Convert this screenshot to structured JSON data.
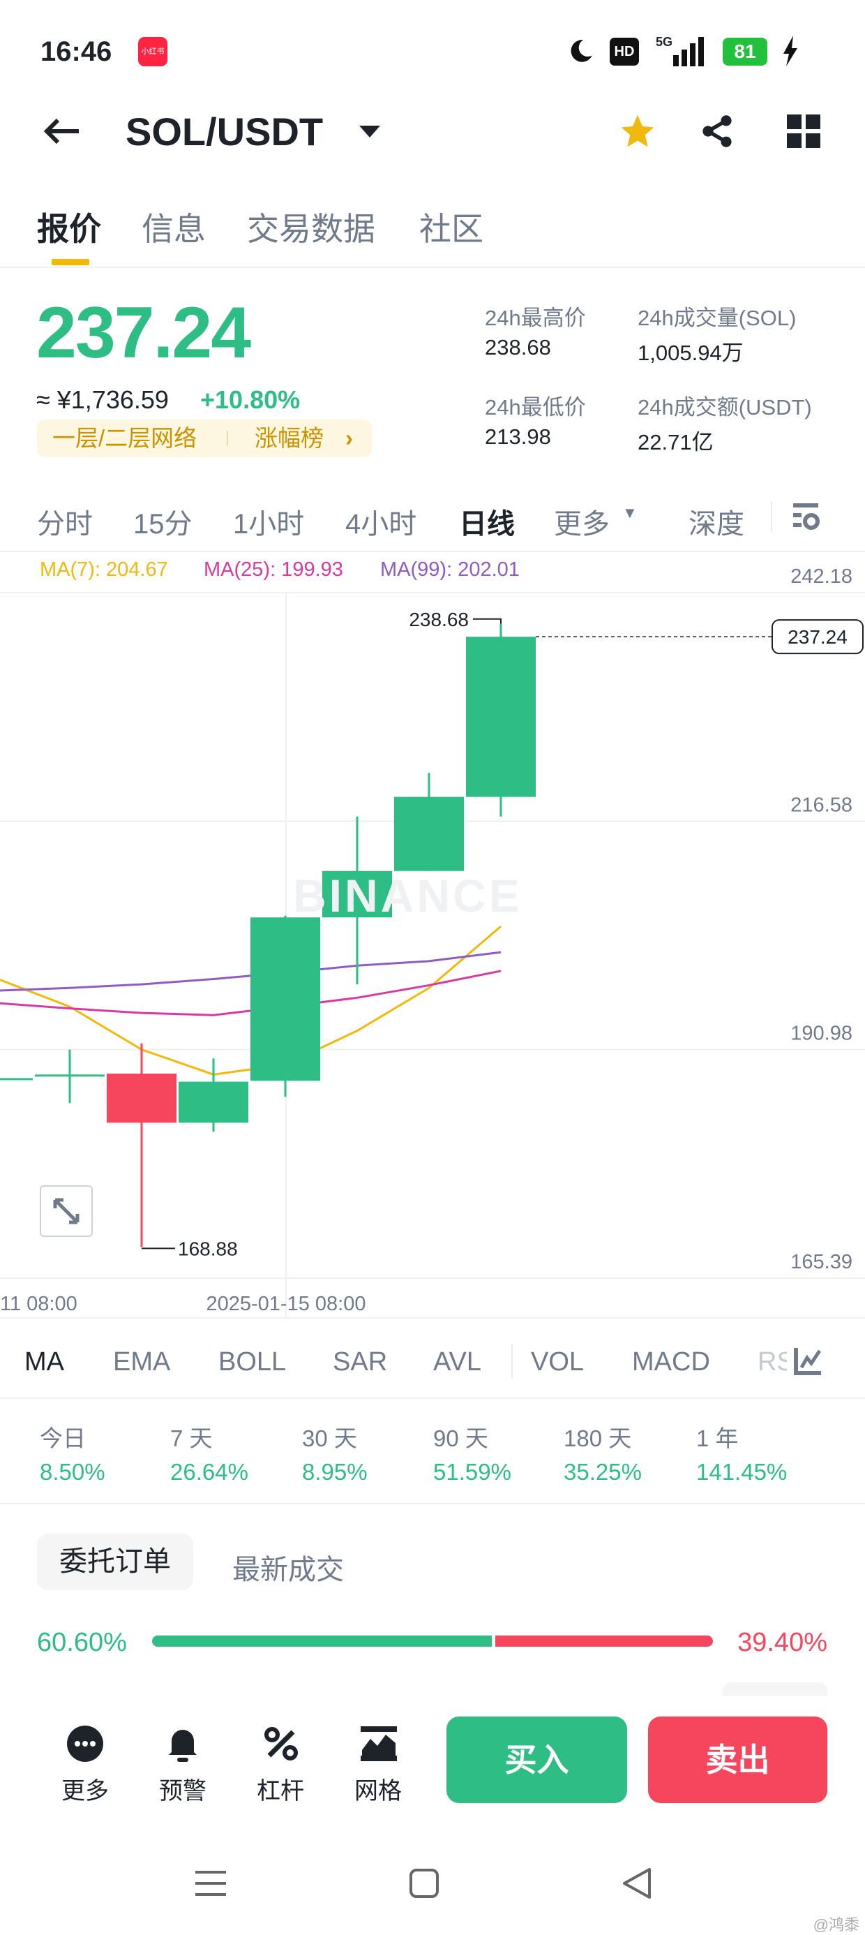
{
  "status_bar": {
    "time": "16:46",
    "app_badge": "小红书",
    "hd": "HD",
    "network": "5G",
    "battery": "81"
  },
  "header": {
    "title": "SOL/USDT"
  },
  "tabs": [
    {
      "label": "报价",
      "active": true
    },
    {
      "label": "信息"
    },
    {
      "label": "交易数据"
    },
    {
      "label": "社区"
    }
  ],
  "price": {
    "last": "237.24",
    "cny": "≈ ¥1,736.59",
    "change": "+10.80%",
    "tag1": "一层/二层网络",
    "tag2": "涨幅榜"
  },
  "stats": {
    "high_label": "24h最高价",
    "high": "238.68",
    "vol_label": "24h成交量(SOL)",
    "vol": "1,005.94万",
    "low_label": "24h最低价",
    "low": "213.98",
    "amount_label": "24h成交额(USDT)",
    "amount": "22.71亿"
  },
  "intervals": [
    "分时",
    "15分",
    "1小时",
    "4小时",
    "日线",
    "更多",
    "深度"
  ],
  "active_interval": "日线",
  "ma_legend": {
    "ma7": "MA(7): 204.67",
    "ma25": "MA(25): 199.93",
    "ma99": "MA(99): 202.01"
  },
  "chart_data": {
    "type": "candlestick",
    "watermark": "BINANCE",
    "y_ticks": [
      "242.18",
      "216.58",
      "190.98",
      "165.39"
    ],
    "ylim": [
      165.39,
      242.18
    ],
    "x_labels": [
      "11 08:00",
      "2025-01-15 08:00"
    ],
    "high_label": "238.68",
    "low_label": "168.88",
    "last_label": "237.24",
    "candles": [
      {
        "o": 187.8,
        "h": 187.9,
        "l": 187.7,
        "c": 187.8
      },
      {
        "o": 188.2,
        "h": 191.0,
        "l": 185.0,
        "c": 188.2
      },
      {
        "o": 188.3,
        "h": 191.7,
        "l": 168.88,
        "c": 182.8
      },
      {
        "o": 182.8,
        "h": 190.0,
        "l": 181.8,
        "c": 187.4
      },
      {
        "o": 187.5,
        "h": 206.0,
        "l": 185.7,
        "c": 205.8
      },
      {
        "o": 205.8,
        "h": 217.1,
        "l": 198.3,
        "c": 211.0
      },
      {
        "o": 211.0,
        "h": 222.0,
        "l": 211.0,
        "c": 219.3
      },
      {
        "o": 219.3,
        "h": 238.68,
        "l": 217.1,
        "c": 237.24
      }
    ],
    "series": [
      {
        "name": "MA(7)",
        "color": "#f0b90b",
        "values": [
          198.9,
          195.8,
          191.0,
          188.2,
          189.3,
          193.1,
          197.9,
          204.8
        ]
      },
      {
        "name": "MA(25)",
        "color": "#d63ba1",
        "values": [
          196.2,
          195.6,
          195.1,
          194.85,
          195.8,
          196.8,
          198.2,
          199.8
        ]
      },
      {
        "name": "MA(99)",
        "color": "#8e5cc4",
        "values": [
          197.6,
          197.9,
          198.3,
          198.9,
          199.6,
          200.4,
          200.9,
          201.9
        ]
      }
    ]
  },
  "indicators": [
    "MA",
    "EMA",
    "BOLL",
    "SAR",
    "AVL",
    "VOL",
    "MACD",
    "RS"
  ],
  "periods": [
    {
      "label": "今日",
      "value": "8.50%"
    },
    {
      "label": "7 天",
      "value": "26.64%"
    },
    {
      "label": "30 天",
      "value": "8.95%"
    },
    {
      "label": "90 天",
      "value": "51.59%"
    },
    {
      "label": "180 天",
      "value": "35.25%"
    },
    {
      "label": "1 年",
      "value": "141.45%"
    }
  ],
  "order_tabs": [
    "委托订单",
    "最新成交"
  ],
  "ratio": {
    "buy": "60.60%",
    "sell": "39.40%",
    "buy_fraction": 0.606
  },
  "bottom_bar": {
    "more": "更多",
    "alert": "预警",
    "leverage": "杠杆",
    "grid": "网格",
    "buy": "买入",
    "sell": "卖出"
  },
  "watermark": "@鸿黍",
  "colors": {
    "up": "#2ebd85",
    "down": "#f6465d",
    "accent": "#f0b90b"
  }
}
